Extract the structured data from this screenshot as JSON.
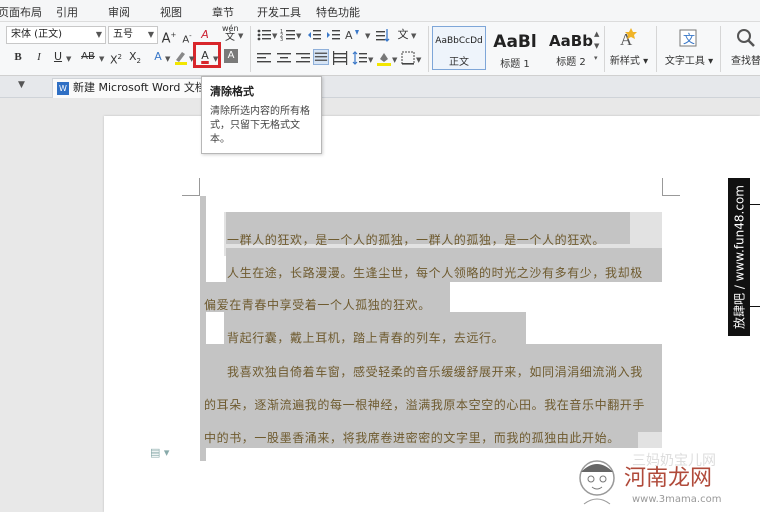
{
  "menu": {
    "items": [
      "页面布局",
      "引用",
      "审阅",
      "视图",
      "章节",
      "开发工具",
      "特色功能"
    ]
  },
  "ribbon": {
    "font_name": "宋体 (正文)",
    "font_size": "五号",
    "grow_font": "A",
    "shrink_font": "A",
    "bold": "B",
    "italic": "I",
    "underline": "U",
    "strike": "AB",
    "superscript": "X",
    "subscript": "X",
    "superscript_mark": "2",
    "subscript_mark": "2",
    "font_color_letter": "A",
    "highlight_letter": "A",
    "char_shade_letter": "A",
    "clear_format_letter": "A",
    "phonetic": "wén",
    "phonetic_char": "文",
    "styles": [
      {
        "sample": "AaBbCcDd",
        "label": "正文"
      },
      {
        "sample": "AaBl",
        "label": "标题 1"
      },
      {
        "sample": "AaBb",
        "label": "标题 2"
      }
    ],
    "new_style_label": "新样式",
    "text_tools_label": "文字工具",
    "find_replace_label": "查找替"
  },
  "tab": {
    "title": "新建 Microsoft Word 文档"
  },
  "tooltip": {
    "title": "清除格式",
    "description": "清除所选内容的所有格式，只留下无格式文本。"
  },
  "document": {
    "lines": [
      "一群人的狂欢，是一个人的孤独，一群人的孤独，是一个人的狂欢。",
      "人生在途，长路漫漫。生逢尘世，每个人领略的时光之沙有多有少，我却极",
      "偏爱在青春中享受着一个人孤独的狂欢。",
      "背起行囊，戴上耳机，踏上青春的列车，去远行。",
      "我喜欢独自倚着车窗，感受轻柔的音乐缓缓舒展开来，如同涓涓细流淌入我",
      "的耳朵，逐渐流遍我的每一根神经，溢满我原本空空的心田。我在音乐中翻开手",
      "中的书，一股墨香涌来，将我席卷进密密的文字里，而我的孤独由此开始。"
    ]
  },
  "watermarks": {
    "side_banner": "放肆吧 / www.fun48.com",
    "logo_text": "河南龙网",
    "url": "www.3mama.com",
    "faded_text": "三妈奶宝儿网"
  },
  "colors": {
    "highlight_box": "#d8262b",
    "selection": "#c4c4c4",
    "text": "#6e5a2e"
  }
}
